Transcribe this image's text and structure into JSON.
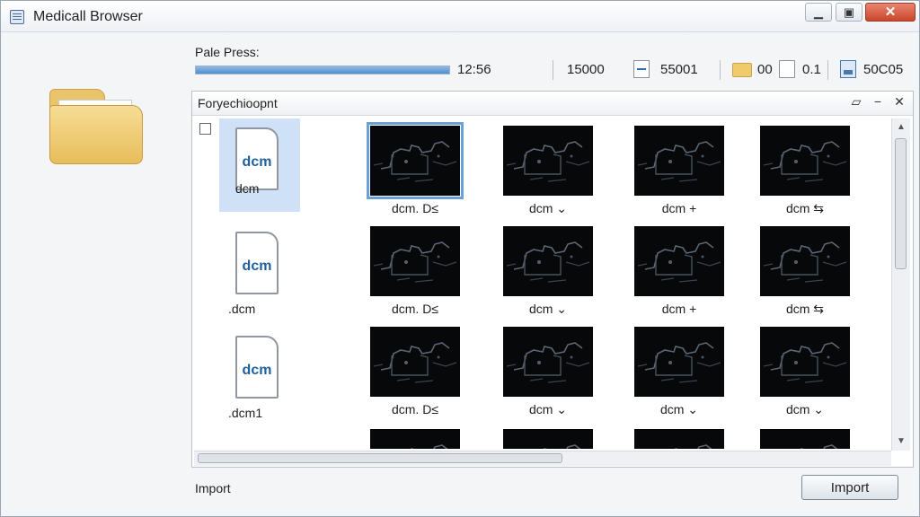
{
  "window": {
    "title": "Medicall Browser",
    "min_glyph": "▁",
    "max_glyph": "▣",
    "close_glyph": "✕"
  },
  "progress": {
    "label": "Pale Press:",
    "fraction": 1.0,
    "time": "12:56",
    "count": "15000",
    "stat_a": "55001",
    "stat_b": "00",
    "stat_c": "0.1",
    "stat_d": "50C05"
  },
  "explorer": {
    "title": "Foryechioopnt",
    "restore_glyph": "▱",
    "minimize_glyph": "−",
    "close_glyph": "✕",
    "files": [
      {
        "icon_text": "dcm",
        "label": "dcm",
        "selected": true
      },
      {
        "icon_text": "dcm",
        "label": ".dcm",
        "selected": false
      },
      {
        "icon_text": "dcm",
        "label": ".dcm1",
        "selected": false
      }
    ],
    "thumbnails": [
      [
        "dcm. D≤",
        "dcm ⌄",
        "dcm +",
        "dcm ⇆"
      ],
      [
        "dcm. D≤",
        "dcm ⌄",
        "dcm +",
        "dcm ⇆"
      ],
      [
        "dcm. D≤",
        "dcm ⌄",
        "dcm ⌄",
        "dcm ⌄"
      ]
    ]
  },
  "footer": {
    "label": "Import",
    "button": "Import"
  },
  "icons": [
    "folder-icon",
    "arrow-box-icon",
    "folder-small-icon",
    "document-icon",
    "disk-icon",
    "cursor-icon"
  ]
}
